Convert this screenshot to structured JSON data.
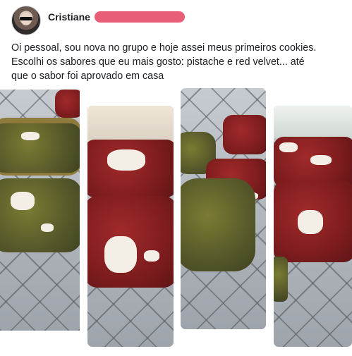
{
  "post": {
    "author_name": "Cristiane",
    "author_name_redacted": true,
    "text_lines": [
      "Oi pessoal, sou nova no grupo e hoje assei meus primeiros cookies.",
      "Escolhi os sabores que eu mais gosto: pistache e red velvet... até",
      "que o sabor foi aprovado em casa"
    ]
  },
  "gallery": {
    "photos": [
      {
        "alt": "photo-1"
      },
      {
        "alt": "photo-2"
      },
      {
        "alt": "photo-3"
      },
      {
        "alt": "photo-4"
      }
    ]
  },
  "colors": {
    "redaction": "#e85d77",
    "text": "#1c1e21",
    "background": "#ffffff"
  }
}
